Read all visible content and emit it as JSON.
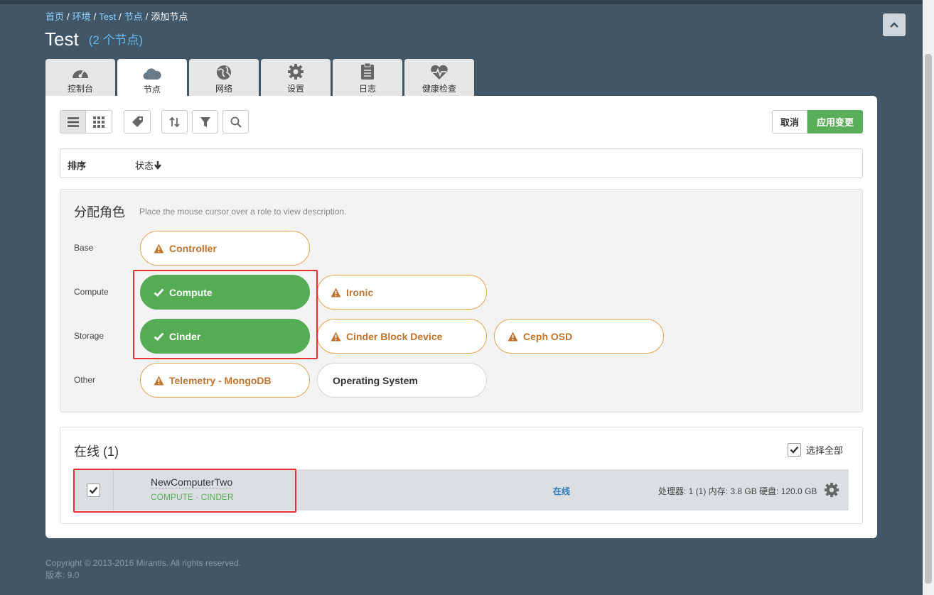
{
  "breadcrumb": {
    "home": "首页",
    "envs": "环境",
    "env": "Test",
    "nodes": "节点",
    "current": "添加节点"
  },
  "header": {
    "title": "Test",
    "count": "(2 个节点)"
  },
  "tabs": [
    {
      "label": "控制台",
      "icon": "dashboard-icon"
    },
    {
      "label": "节点",
      "icon": "cloud-icon"
    },
    {
      "label": "网络",
      "icon": "globe-icon"
    },
    {
      "label": "设置",
      "icon": "gear-icon"
    },
    {
      "label": "日志",
      "icon": "clipboard-icon"
    },
    {
      "label": "健康检查",
      "icon": "heart-pulse-icon"
    }
  ],
  "toolbar": {
    "cancel_label": "取消",
    "apply_label": "应用变更"
  },
  "sort": {
    "label": "排序",
    "status": "状态"
  },
  "roles": {
    "heading": "分配角色",
    "hint": "Place the mouse cursor over a role to view description.",
    "groups": {
      "base": "Base",
      "compute": "Compute",
      "storage": "Storage",
      "other": "Other"
    },
    "items": {
      "controller": "Controller",
      "compute": "Compute",
      "ironic": "Ironic",
      "cinder": "Cinder",
      "cinder_block": "Cinder Block Device",
      "ceph": "Ceph OSD",
      "telemetry": "Telemetry - MongoDB",
      "os": "Operating System"
    }
  },
  "online": {
    "heading": "在线 (1)",
    "select_all": "选择全部",
    "node": {
      "name": "NewComputerTwo",
      "roles": "COMPUTE · CINDER",
      "status": "在线",
      "specs": "处理器: 1 (1) 内存: 3.8 GB 硬盘: 120.0 GB"
    }
  },
  "footer": {
    "copyright": "Copyright © 2013-2016 Mirantis. All rights reserved.",
    "version": "版本: 9.0"
  },
  "colors": {
    "accent_green": "#5aae59",
    "warning_orange": "#c0732a",
    "link_blue": "#8fd1ff",
    "background": "#415767"
  }
}
